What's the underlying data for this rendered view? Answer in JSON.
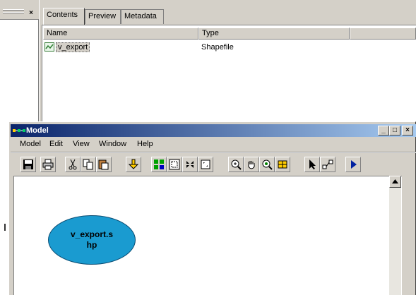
{
  "catalog": {
    "left_close": "×",
    "tabs": [
      {
        "label": "Contents",
        "active": true
      },
      {
        "label": "Preview",
        "active": false
      },
      {
        "label": "Metadata",
        "active": false
      }
    ],
    "columns": [
      "Name",
      "Type"
    ],
    "rows": [
      {
        "name": "v_export",
        "type": "Shapefile",
        "icon": "shapefile-icon"
      }
    ]
  },
  "model_window": {
    "title": "Model",
    "controls": {
      "minimize": "_",
      "maximize": "□",
      "close": "×"
    },
    "menu": [
      "Model",
      "Edit",
      "View",
      "Window",
      "Help"
    ],
    "toolbar": [
      "save-icon",
      "print-icon",
      "cut-icon",
      "copy-icon",
      "paste-icon",
      "add-data-icon",
      "auto-layout-icon",
      "full-extent-icon",
      "zoom-in-fixed-icon",
      "zoom-out-fixed-icon",
      "zoom-in-icon",
      "pan-icon",
      "zoom-out-icon",
      "layer-icon",
      "select-icon",
      "connect-icon",
      "run-icon"
    ],
    "node": {
      "label": "v_export.s\nhp",
      "color": "#1a9bd0"
    }
  },
  "colors": {
    "titlebar_start": "#0a246a",
    "titlebar_end": "#a6caf0",
    "node_fill": "#1a9bd0",
    "face": "#d4d0c8"
  }
}
